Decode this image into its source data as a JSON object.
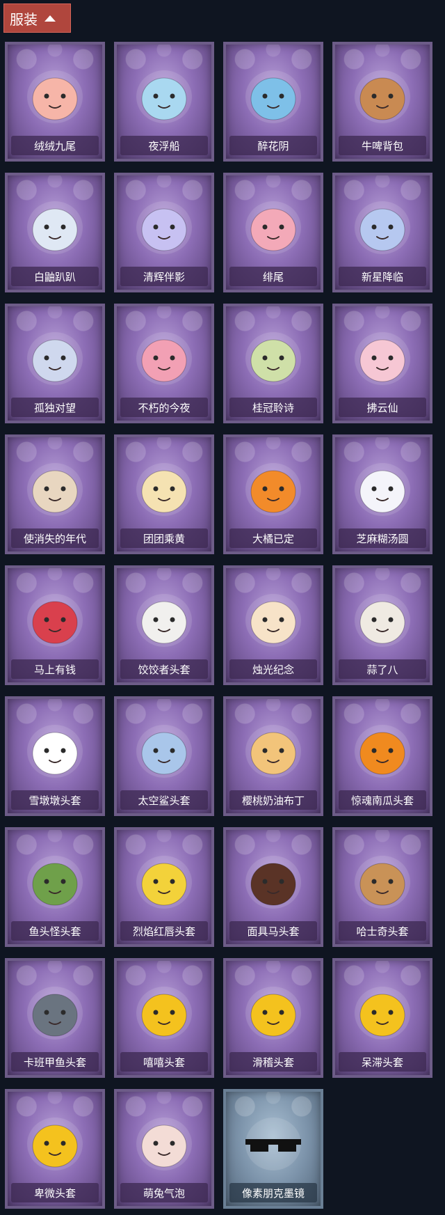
{
  "header": {
    "title": "服装"
  },
  "items": [
    {
      "label": "绒绒九尾",
      "icon": "nine-tail-fox-icon",
      "color": "#f6b5a8",
      "frame": "purple"
    },
    {
      "label": "夜浮船",
      "icon": "jellyfish-icon",
      "color": "#a9d8f0",
      "frame": "purple"
    },
    {
      "label": "醉花阴",
      "icon": "flower-dreamcatcher-icon",
      "color": "#7ec0e8",
      "frame": "purple"
    },
    {
      "label": "牛啤背包",
      "icon": "cow-beer-mug-icon",
      "color": "#c98a52",
      "frame": "purple"
    },
    {
      "label": "白鼬趴趴",
      "icon": "white-weasel-icon",
      "color": "#dfe8f4",
      "frame": "purple"
    },
    {
      "label": "清辉伴影",
      "icon": "silver-haired-charm-icon",
      "color": "#c7c1f2",
      "frame": "purple"
    },
    {
      "label": "绯尾",
      "icon": "pink-fox-girl-charm-icon",
      "color": "#f3a9b8",
      "frame": "purple"
    },
    {
      "label": "新星降临",
      "icon": "starry-boy-charm-icon",
      "color": "#b6c8f0",
      "frame": "purple"
    },
    {
      "label": "孤独对望",
      "icon": "moon-girl-charm-icon",
      "color": "#cfd8ee",
      "frame": "purple"
    },
    {
      "label": "不朽的今夜",
      "icon": "pink-cat-bowl-icon",
      "color": "#f2a0b4",
      "frame": "purple"
    },
    {
      "label": "桂冠聆诗",
      "icon": "laurel-poet-charm-icon",
      "color": "#cfe0a8",
      "frame": "purple"
    },
    {
      "label": "拂云仙",
      "icon": "cloud-fairy-charm-icon",
      "color": "#f6c7d4",
      "frame": "purple"
    },
    {
      "label": "使消失的年代",
      "icon": "veiled-girl-doll-icon",
      "color": "#e8d6c0",
      "frame": "purple"
    },
    {
      "label": "团团乘黄",
      "icon": "round-cat-head-icon",
      "color": "#f5e2b2",
      "frame": "purple"
    },
    {
      "label": "大橘已定",
      "icon": "orange-slice-icon",
      "color": "#f28b2a",
      "frame": "purple"
    },
    {
      "label": "芝麻糊汤圆",
      "icon": "rice-ball-icon",
      "color": "#f4f4fa",
      "frame": "purple"
    },
    {
      "label": "马上有钱",
      "icon": "red-horse-head-icon",
      "color": "#d9404d",
      "frame": "purple"
    },
    {
      "label": "饺饺者头套",
      "icon": "dumpling-head-icon",
      "color": "#f1f0ee",
      "frame": "purple"
    },
    {
      "label": "烛光纪念",
      "icon": "candle-head-icon",
      "color": "#f7e3c8",
      "frame": "purple"
    },
    {
      "label": "蒜了八",
      "icon": "garlic-head-icon",
      "color": "#efeae2",
      "frame": "purple"
    },
    {
      "label": "雪墩墩头套",
      "icon": "snowman-head-icon",
      "color": "#ffffff",
      "frame": "purple"
    },
    {
      "label": "太空鲨头套",
      "icon": "shark-head-icon",
      "color": "#a9c6ea",
      "frame": "purple"
    },
    {
      "label": "樱桃奶油布丁",
      "icon": "pudding-head-icon",
      "color": "#f2c47a",
      "frame": "purple"
    },
    {
      "label": "惊魂南瓜头套",
      "icon": "pumpkin-head-icon",
      "color": "#f08a1f",
      "frame": "purple"
    },
    {
      "label": "鱼头怪头套",
      "icon": "fish-monster-head-icon",
      "color": "#6fa04a",
      "frame": "purple"
    },
    {
      "label": "烈焰红唇头套",
      "icon": "yellow-mouse-head-icon",
      "color": "#f3d23a",
      "frame": "purple"
    },
    {
      "label": "面具马头套",
      "icon": "horse-mask-head-icon",
      "color": "#5a3326",
      "frame": "purple"
    },
    {
      "label": "哈士奇头套",
      "icon": "husky-head-icon",
      "color": "#c99257",
      "frame": "purple"
    },
    {
      "label": "卡班甲鱼头套",
      "icon": "whale-head-icon",
      "color": "#6a7480",
      "frame": "purple"
    },
    {
      "label": "嘻嘻头套",
      "icon": "grin-emoji-head-icon",
      "color": "#f4c21e",
      "frame": "purple"
    },
    {
      "label": "滑稽头套",
      "icon": "smirk-emoji-head-icon",
      "color": "#f4c21e",
      "frame": "purple"
    },
    {
      "label": "呆滞头套",
      "icon": "dazed-emoji-head-icon",
      "color": "#f4c21e",
      "frame": "purple"
    },
    {
      "label": "卑微头套",
      "icon": "humble-emoji-head-icon",
      "color": "#f4c21e",
      "frame": "purple"
    },
    {
      "label": "萌兔气泡",
      "icon": "bunny-bubble-head-icon",
      "color": "#f3dcd6",
      "frame": "purple"
    },
    {
      "label": "像素朋克墨镜",
      "icon": "pixel-sunglasses-icon",
      "color": "#111111",
      "frame": "blue"
    }
  ]
}
